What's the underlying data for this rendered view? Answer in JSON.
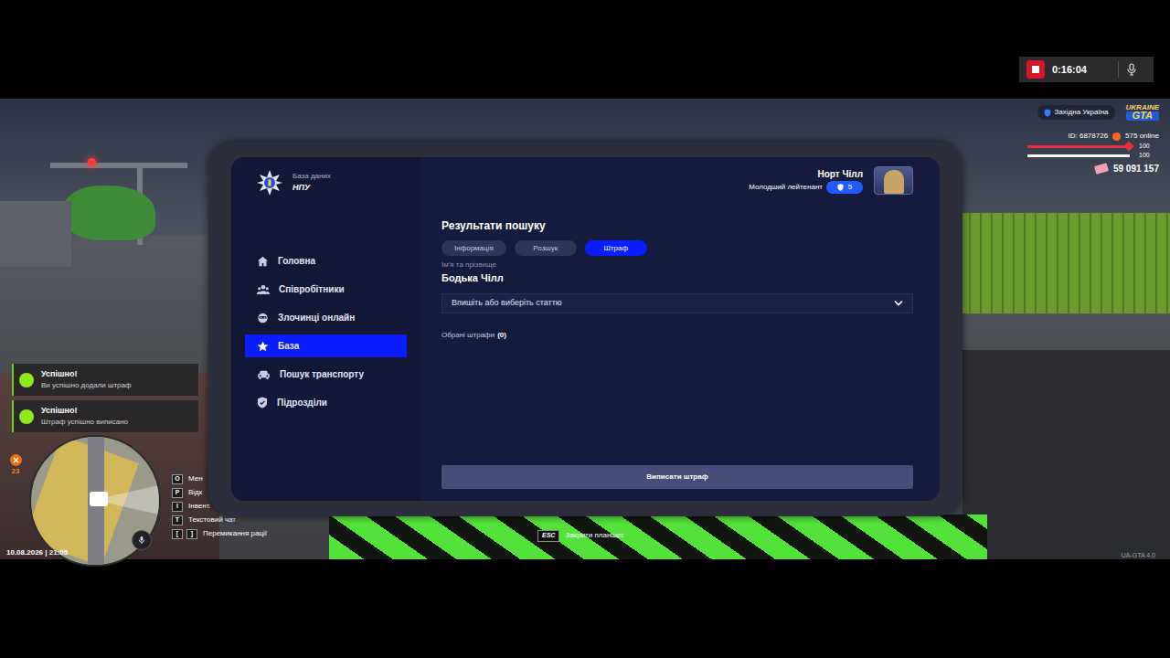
{
  "recorder": {
    "time": "0:16:04"
  },
  "hud": {
    "region": "Західна Україна",
    "logo": {
      "top": "UKRAINE",
      "bottom": "GTA"
    },
    "player_id": "ID: 6878726",
    "online": "575 online",
    "bars": [
      {
        "value": "100",
        "level": 1,
        "color": "#e8323e"
      },
      {
        "value": "100",
        "level": 1,
        "color": "#ffffff"
      }
    ],
    "money": "59 091 157"
  },
  "notifications": [
    {
      "title": "Успішно!",
      "text": "Ви успішно додали штраф"
    },
    {
      "title": "Успішно!",
      "text": "Штраф успішно виписано"
    }
  ],
  "quest_counter": "23",
  "hints": [
    {
      "keys": [
        "O"
      ],
      "label": "Мен"
    },
    {
      "keys": [
        "P"
      ],
      "label": "Відк"
    },
    {
      "keys": [
        "I"
      ],
      "label": "Інвент."
    },
    {
      "keys": [
        "T"
      ],
      "label": "Текстовий чат"
    },
    {
      "keys": [
        "[",
        "]"
      ],
      "label": "Перемикання рації"
    }
  ],
  "datetime": "10.08.2026 | 21:05",
  "close_hint": {
    "key": "ESC",
    "label": "Закрити планшет"
  },
  "version": "UA-GTA 4.0",
  "tablet": {
    "logo": {
      "subtitle": "База даних",
      "title": "НПУ"
    },
    "menu": [
      {
        "label": "Головна",
        "selected": false
      },
      {
        "label": "Співробітники",
        "selected": false
      },
      {
        "label": "Злочинці онлайн",
        "selected": false
      },
      {
        "label": "База",
        "selected": true
      },
      {
        "label": "Пошук транспорту",
        "selected": false
      },
      {
        "label": "Підрозділи",
        "selected": false
      }
    ],
    "user": {
      "name": "Норт Чілл",
      "rank": "Молодший лейтенант",
      "level": "5"
    },
    "search": {
      "title": "Результати пошуку",
      "tabs": [
        {
          "label": "Інформація",
          "selected": false
        },
        {
          "label": "Розшук",
          "selected": false
        },
        {
          "label": "Штраф",
          "selected": true
        }
      ],
      "name_label": "Ім'я та прізвище",
      "name": "Бодька Чілл",
      "select_placeholder": "Впишіть або виберіть статтю",
      "chosen_label": "Обрані штрафи",
      "chosen_count": "(0)",
      "submit": "Виписати штраф"
    }
  }
}
